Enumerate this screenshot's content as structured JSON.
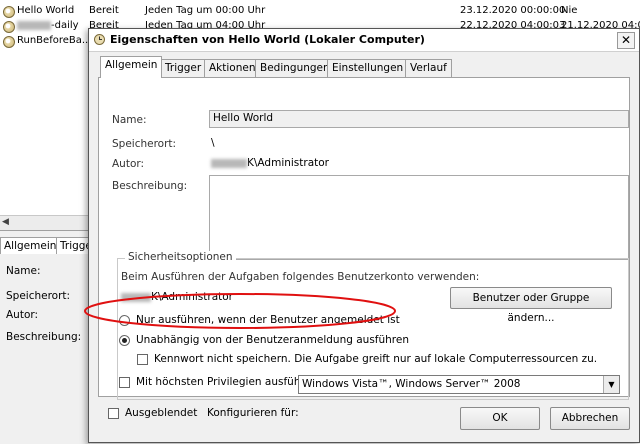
{
  "tasks": [
    {
      "name": "Hello World",
      "status": "Bereit",
      "trigger": "Jeden Tag um 00:00 Uhr",
      "next_run": "23.12.2020 00:00:00",
      "last_run": "Nie"
    },
    {
      "name_suffix": "-daily",
      "status": "Bereit",
      "trigger": "Jeden Tag um 04:00 Uhr",
      "next_run": "22.12.2020 04:00:03",
      "last_run": "21.12.2020 04:00:0"
    },
    {
      "name": "RunBeforeBa..."
    }
  ],
  "background_details": {
    "tabs": [
      "Allgemein",
      "Trigge"
    ],
    "labels": [
      "Name:",
      "Speicherort:",
      "Autor:",
      "Beschreibung:"
    ]
  },
  "dialog": {
    "title": "Eigenschaften von Hello World (Lokaler Computer)",
    "close_symbol": "✕",
    "tabs": [
      "Allgemein",
      "Trigger",
      "Aktionen",
      "Bedingungen",
      "Einstellungen",
      "Verlauf"
    ],
    "general": {
      "name_label": "Name:",
      "name_value": "Hello World",
      "location_label": "Speicherort:",
      "location_value": "\\",
      "author_label": "Autor:",
      "author_value": "K\\Administrator",
      "description_label": "Beschreibung:",
      "description_value": ""
    },
    "security": {
      "group_title": "Sicherheitsoptionen",
      "account_prompt": "Beim Ausführen der Aufgaben folgendes Benutzerkonto verwenden:",
      "account_value": "K\\Administrator",
      "change_user_button": "Benutzer oder Gruppe ändern...",
      "radio_logged_on": "Nur ausführen, wenn der Benutzer angemeldet ist",
      "radio_independent": "Unabhängig von der Benutzeranmeldung ausführen",
      "selected_radio": "independent",
      "no_password_checkbox": "Kennwort nicht speichern. Die Aufgabe greift nur auf lokale Computerressourcen zu.",
      "highest_privileges_checkbox": "Mit höchsten Privilegien ausführen"
    },
    "hidden_checkbox": "Ausgeblendet",
    "configure_label": "Konfigurieren für:",
    "configure_value": "Windows Vista™, Windows Server™ 2008",
    "ok_button": "OK",
    "cancel_button": "Abbrechen"
  },
  "colors": {
    "highlight_ellipse": "#e01010"
  }
}
